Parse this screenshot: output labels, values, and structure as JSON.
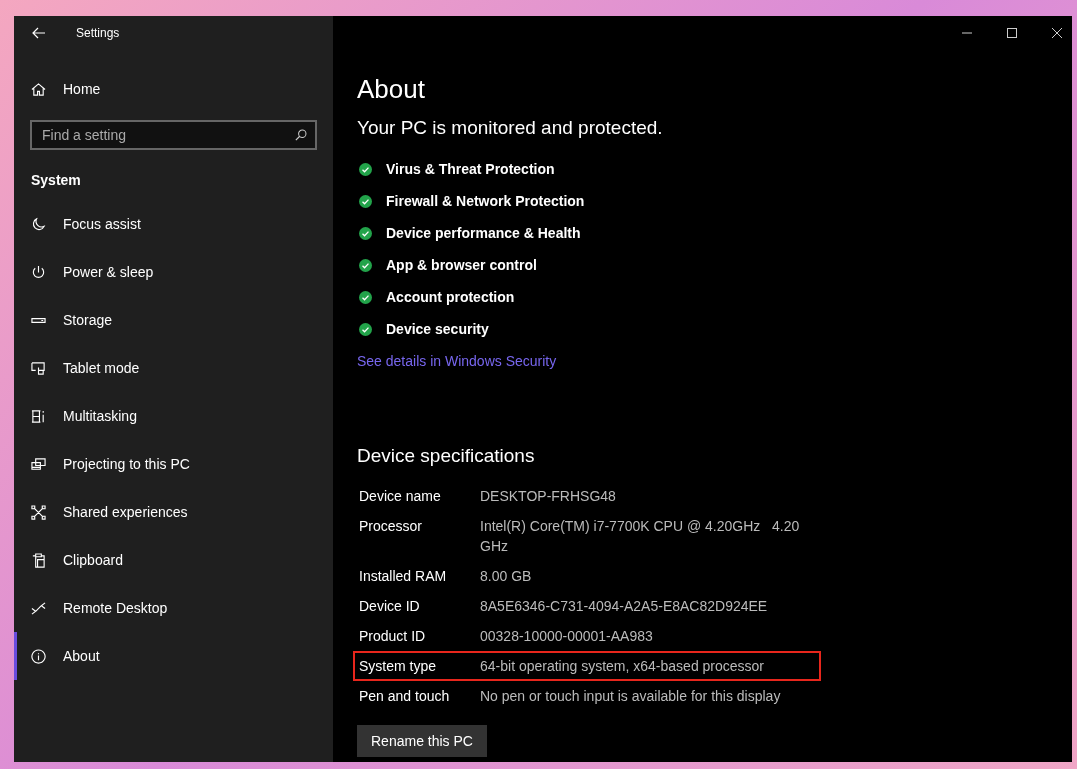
{
  "window": {
    "title": "Settings"
  },
  "sidebar": {
    "home": "Home",
    "search": {
      "placeholder": "Find a setting"
    },
    "section": "System",
    "items": [
      {
        "label": "Focus assist",
        "selected": false
      },
      {
        "label": "Power & sleep",
        "selected": false
      },
      {
        "label": "Storage",
        "selected": false
      },
      {
        "label": "Tablet mode",
        "selected": false
      },
      {
        "label": "Multitasking",
        "selected": false
      },
      {
        "label": "Projecting to this PC",
        "selected": false
      },
      {
        "label": "Shared experiences",
        "selected": false
      },
      {
        "label": "Clipboard",
        "selected": false
      },
      {
        "label": "Remote Desktop",
        "selected": false
      },
      {
        "label": "About",
        "selected": true
      }
    ]
  },
  "main": {
    "title": "About",
    "status": "Your PC is monitored and protected.",
    "protections": [
      {
        "label": "Virus & Threat Protection",
        "color": "#22a34a"
      },
      {
        "label": "Firewall & Network Protection",
        "color": "#22a34a"
      },
      {
        "label": "Device performance & Health",
        "color": "#22a34a"
      },
      {
        "label": "App & browser control",
        "color": "#22a34a"
      },
      {
        "label": "Account protection",
        "color": "#22a34a"
      },
      {
        "label": "Device security",
        "color": "#22a34a"
      }
    ],
    "link": "See details in Windows Security",
    "specs_title": "Device specifications",
    "specs": [
      {
        "label": "Device name",
        "value": "DESKTOP-FRHSG48",
        "highlighted": false
      },
      {
        "label": "Processor",
        "value": "Intel(R) Core(TM) i7-7700K CPU @ 4.20GHz   4.20 GHz",
        "highlighted": false
      },
      {
        "label": "Installed RAM",
        "value": "8.00 GB",
        "highlighted": false
      },
      {
        "label": "Device ID",
        "value": "8A5E6346-C731-4094-A2A5-E8AC82D924EE",
        "highlighted": false
      },
      {
        "label": "Product ID",
        "value": "00328-10000-00001-AA983",
        "highlighted": false
      },
      {
        "label": "System type",
        "value": "64-bit operating system, x64-based processor",
        "highlighted": true
      },
      {
        "label": "Pen and touch",
        "value": "No pen or touch input is available for this display",
        "highlighted": false
      }
    ],
    "button": "Rename this PC"
  }
}
